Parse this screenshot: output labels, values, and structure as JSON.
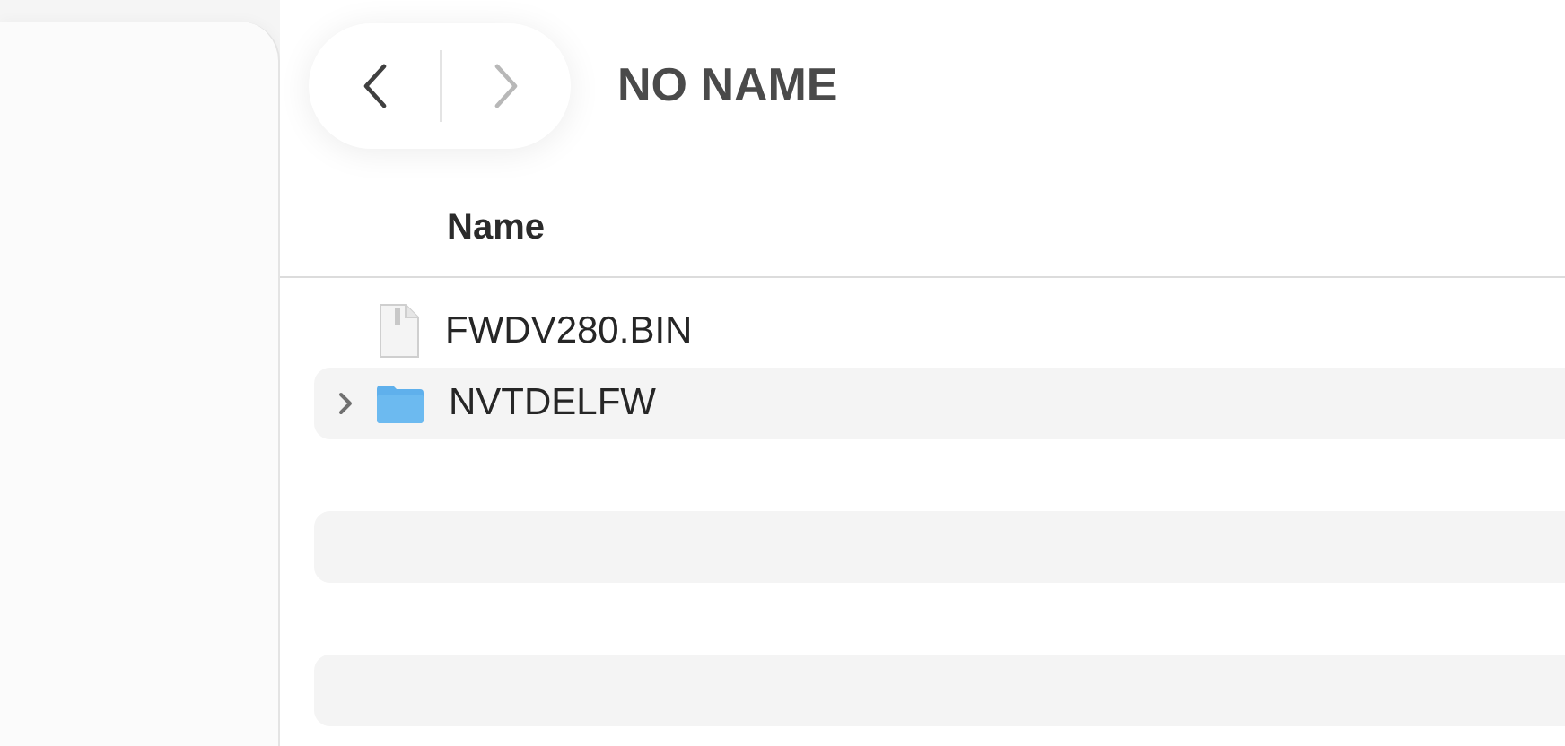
{
  "toolbar": {
    "nav": [
      {
        "kind": "back",
        "disabled": false
      },
      {
        "kind": "forward",
        "disabled": true
      }
    ],
    "title": "NO NAME"
  },
  "table": {
    "columns": [
      "Name"
    ],
    "rows": [
      {
        "kind": "file",
        "name": "FWDV280.BIN",
        "expandable": false
      },
      {
        "kind": "folder",
        "name": "NVTDELFW",
        "expandable": true
      }
    ]
  }
}
